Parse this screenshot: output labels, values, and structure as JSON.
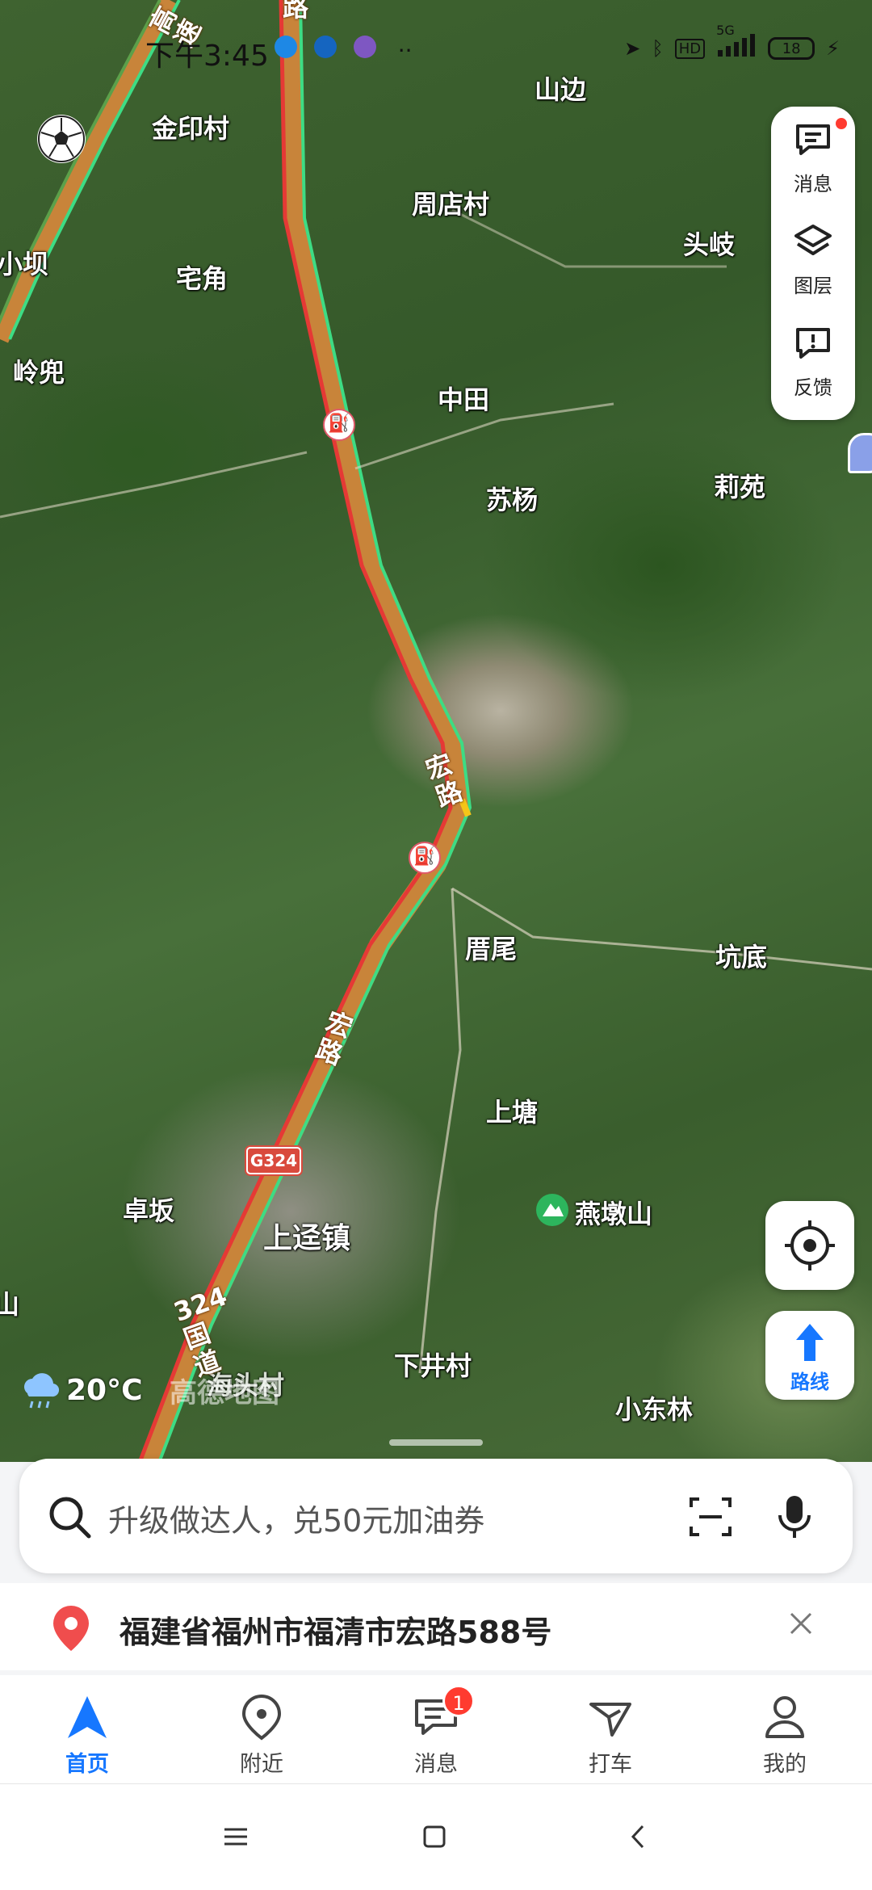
{
  "status_bar": {
    "time": "下午3:45",
    "battery": "18",
    "network": "5G",
    "hd": "HD"
  },
  "map": {
    "places": [
      {
        "id": "shanbian",
        "name": "山边"
      },
      {
        "id": "jinyincun",
        "name": "金印村"
      },
      {
        "id": "zhoudiancun",
        "name": "周店村"
      },
      {
        "id": "touqi",
        "name": "头岐"
      },
      {
        "id": "xiaoba",
        "name": "小坝"
      },
      {
        "id": "zhaijiao",
        "name": "宅角"
      },
      {
        "id": "lingdou",
        "name": "岭兜"
      },
      {
        "id": "zhongtian",
        "name": "中田"
      },
      {
        "id": "suyang",
        "name": "苏杨"
      },
      {
        "id": "liyuan",
        "name": "莉苑"
      },
      {
        "id": "cuowei",
        "name": "厝尾"
      },
      {
        "id": "kengdi",
        "name": "坑底"
      },
      {
        "id": "shangtang",
        "name": "上塘"
      },
      {
        "id": "yandunshan",
        "name": "燕墩山"
      },
      {
        "id": "zhuoban",
        "name": "卓坂"
      },
      {
        "id": "shangjingzhen",
        "name": "上迳镇"
      },
      {
        "id": "xiajingcun",
        "name": "下井村"
      },
      {
        "id": "xiaodonglin",
        "name": "小东林"
      },
      {
        "id": "shan",
        "name": "山"
      },
      {
        "id": "haitoucun",
        "name": "海头村"
      }
    ],
    "roads": {
      "gaosu": "高速",
      "hong_lu_1": "宏路",
      "hong_lu_2": "宏路",
      "guodao": "324国道",
      "lu_top": "路",
      "shield": "G324"
    },
    "weather": "20°C",
    "logo": "高德地图"
  },
  "tools": [
    {
      "id": "messages",
      "label": "消息",
      "icon": "message-icon",
      "has_dot": true
    },
    {
      "id": "layers",
      "label": "图层",
      "icon": "layers-icon"
    },
    {
      "id": "feedback",
      "label": "反馈",
      "icon": "feedback-icon"
    }
  ],
  "route_button": {
    "label": "路线"
  },
  "search": {
    "placeholder": "升级做达人，兑50元加油券"
  },
  "address": {
    "text": "福建省福州市福清市宏路588号"
  },
  "tabs": [
    {
      "id": "home",
      "label": "首页",
      "icon": "navigate-arrow-icon",
      "active": true
    },
    {
      "id": "nearby",
      "label": "附近",
      "icon": "location-pin-icon"
    },
    {
      "id": "messages",
      "label": "消息",
      "icon": "chat-icon",
      "badge": "1"
    },
    {
      "id": "taxi",
      "label": "打车",
      "icon": "taxi-icon"
    },
    {
      "id": "mine",
      "label": "我的",
      "icon": "person-icon"
    }
  ],
  "colors": {
    "accent": "#1677ff",
    "badge": "#ff3b30",
    "traffic_green": "#3ddc84",
    "traffic_red": "#e53935",
    "road": "#c8843a"
  }
}
